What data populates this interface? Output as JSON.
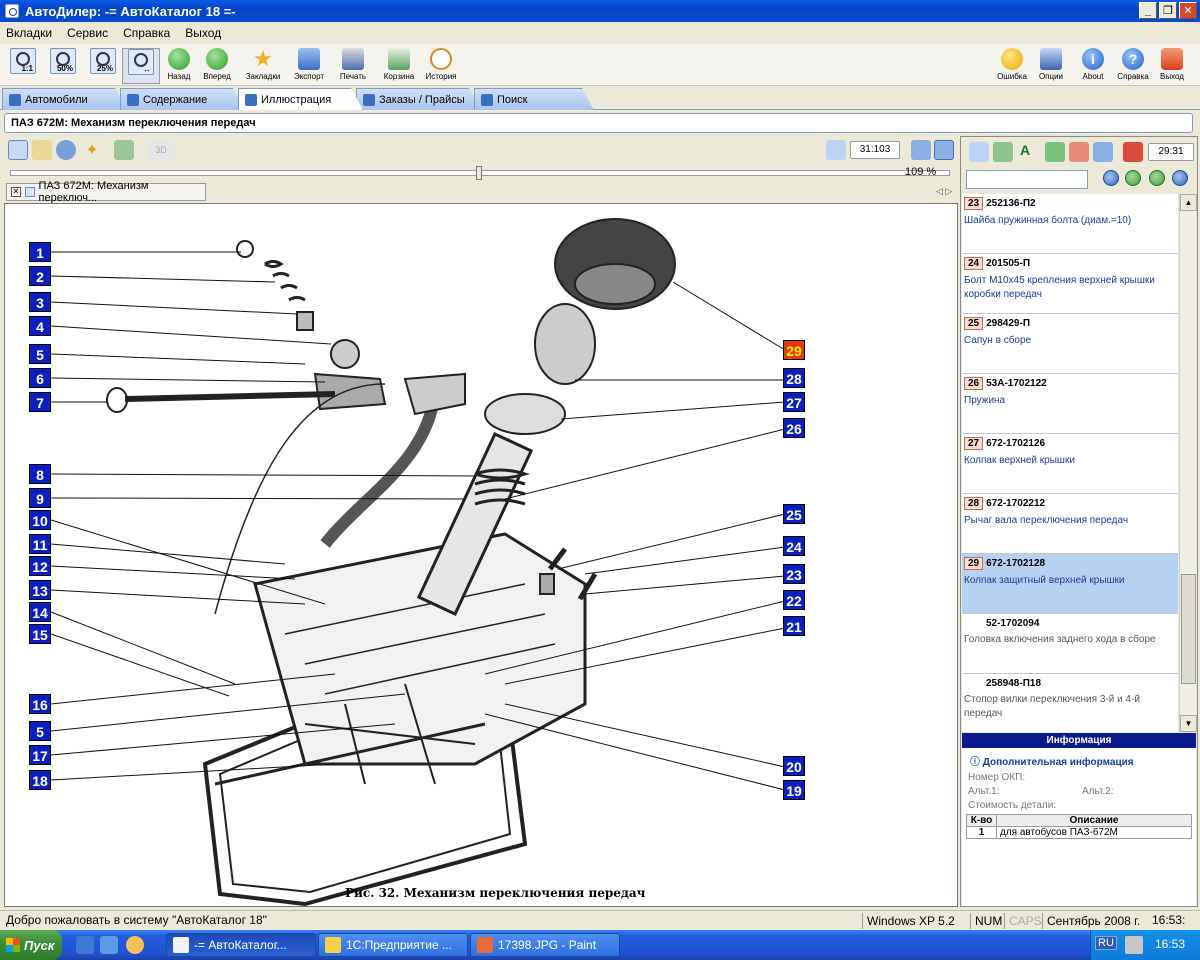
{
  "window": {
    "title": "АвтоДилер: -= АвтоКаталог 18 =-"
  },
  "menu": [
    "Вкладки",
    "Сервис",
    "Справка",
    "Выход"
  ],
  "toolbar": {
    "zoom": [
      "1:1",
      "50%",
      "25%",
      ""
    ],
    "buttons": [
      "Назад",
      "Вперед",
      "Закладки",
      "Экспорт",
      "Печать",
      "Корзина",
      "История"
    ],
    "right": [
      "Ошибка",
      "Опции",
      "About",
      "Справка",
      "Выход"
    ]
  },
  "tabs": [
    "Автомобили",
    "Содержание",
    "Иллюстрация",
    "Заказы / Прайсы",
    "Поиск"
  ],
  "path": "ПАЗ 672М: Механизм переключения передач",
  "counter_left": "31:103",
  "counter_right": "29:31",
  "zoom_pct": "109 %",
  "doc_tab": "ПАЗ 672М: Механизм переключ...",
  "caption": "Рис. 32. Механизм переключения передач",
  "left_callouts": [
    "1",
    "2",
    "3",
    "4",
    "5",
    "6",
    "7",
    "8",
    "9",
    "10",
    "11",
    "12",
    "13",
    "14",
    "15",
    "16",
    "5",
    "17",
    "18"
  ],
  "right_callouts": [
    "29",
    "28",
    "27",
    "26",
    "25",
    "24",
    "23",
    "22",
    "21",
    "20",
    "19"
  ],
  "parts": [
    {
      "num": "23",
      "code": "252136-П2",
      "desc": "Шайба пружинная болта (диам.=10)"
    },
    {
      "num": "24",
      "code": "201505-П",
      "desc": "Болт М10х45 крепления верхней крышки коробки передач"
    },
    {
      "num": "25",
      "code": "298429-П",
      "desc": "Сапун в сборе"
    },
    {
      "num": "26",
      "code": "53А-1702122",
      "desc": "Пружина"
    },
    {
      "num": "27",
      "code": "672-1702126",
      "desc": "Колпак верхней крышки"
    },
    {
      "num": "28",
      "code": "672-1702212",
      "desc": "Рычаг вала переключения передач"
    },
    {
      "num": "29",
      "code": "672-1702128",
      "desc": "Колпак защитный верхней крышки"
    },
    {
      "num": "",
      "code": "52-1702094",
      "desc": "Головка включения заднего хода в сборе"
    },
    {
      "num": "",
      "code": "258948-П18",
      "desc": "Стопор вилки переключения 3-й и 4-й передач"
    }
  ],
  "info": {
    "header": "Информация",
    "title": "Дополнительная информация",
    "okp": "Номер ОКП:",
    "alt1": "Альт.1:",
    "alt2": "Альт.2:",
    "cost": "Стоимость детали:",
    "col_qty": "К-во",
    "col_desc": "Описание",
    "row_qty": "1",
    "row_desc": "для автобусов ПАЗ-672М"
  },
  "status": {
    "welcome": "Добро пожаловать в систему \"АвтоКаталог 18\"",
    "os": "Windows XP 5.2",
    "num": "NUM",
    "caps": "CAPS",
    "date": "Сентябрь 2008 г.",
    "time": "16:53:"
  },
  "taskbar": {
    "start": "Пуск",
    "tasks": [
      "-= АвтоКаталог...",
      "1С:Предприятие ...",
      "17398.JPG - Paint"
    ],
    "lang": "RU",
    "clock": "16:53"
  }
}
